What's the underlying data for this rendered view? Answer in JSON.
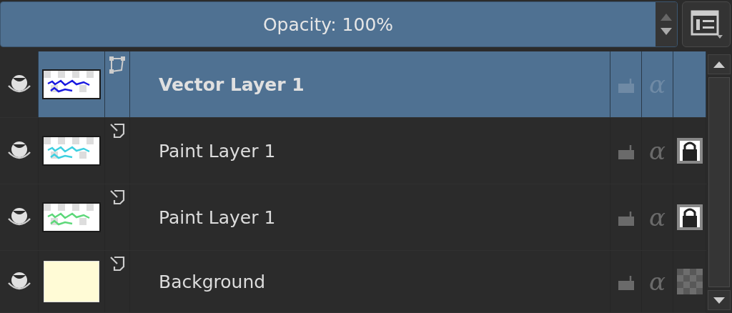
{
  "opacity": {
    "label": "Opacity:  100%",
    "level": 1.0
  },
  "layers": [
    {
      "name": "Vector Layer 1",
      "kind": "vector",
      "selected": true,
      "visible": true,
      "locked": false,
      "alpha_symbol": "α",
      "thumbnail": {
        "kind": "strokes",
        "color": "#1a1ae0"
      }
    },
    {
      "name": "Paint Layer 1",
      "kind": "paint",
      "selected": false,
      "visible": true,
      "locked": false,
      "alpha_symbol": "α",
      "inherit_alpha": true,
      "thumbnail": {
        "kind": "strokes",
        "color": "#3ed0e0"
      }
    },
    {
      "name": "Paint Layer 1",
      "kind": "paint",
      "selected": false,
      "visible": true,
      "locked": false,
      "alpha_symbol": "α",
      "inherit_alpha": true,
      "thumbnail": {
        "kind": "strokes",
        "color": "#5ed87a"
      }
    },
    {
      "name": "Background",
      "kind": "paint",
      "selected": false,
      "visible": true,
      "locked": false,
      "alpha_symbol": "α",
      "inherit_alpha": false,
      "thumbnail": {
        "kind": "fill",
        "color": "#fffbd6"
      }
    }
  ]
}
